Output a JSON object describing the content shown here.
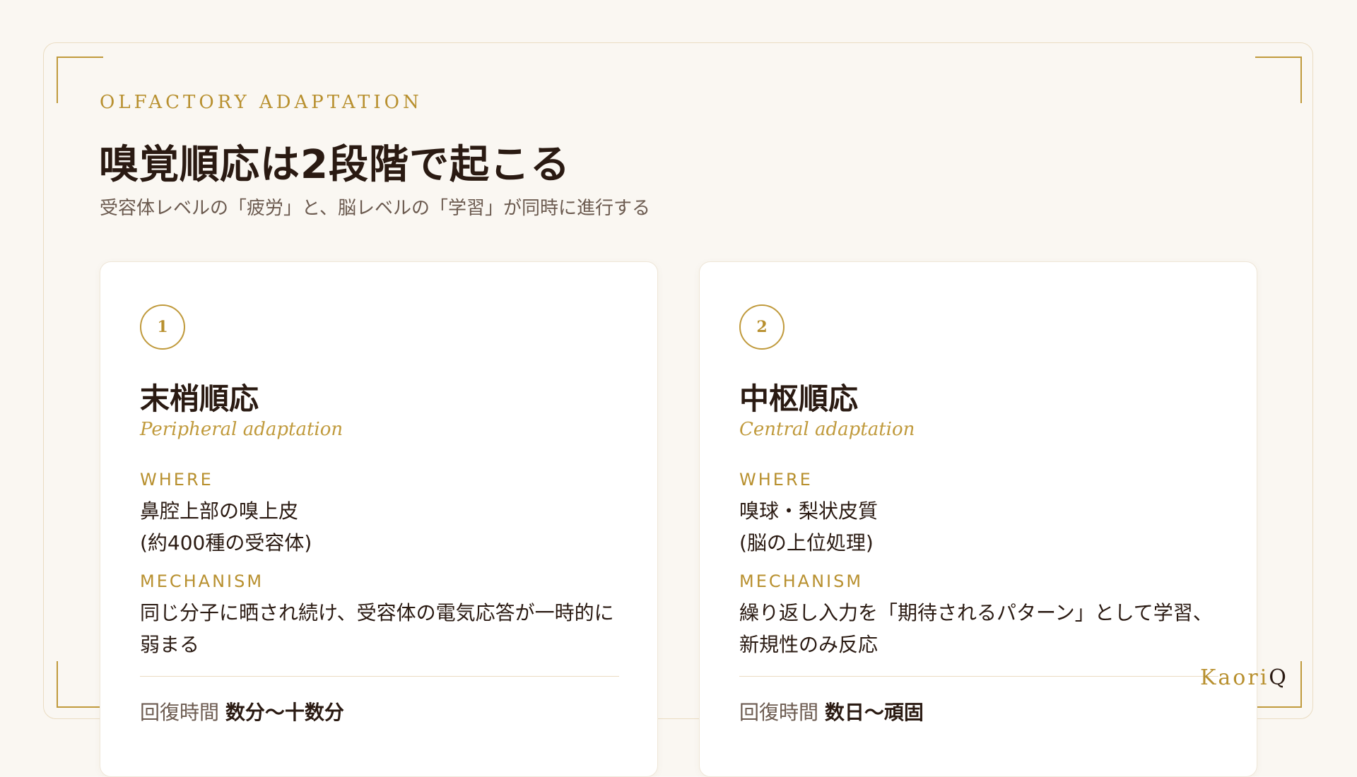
{
  "header": {
    "eyebrow": "OLFACTORY ADAPTATION",
    "title": "嗅覚順応は2段階で起こる",
    "subtitle": "受容体レベルの「疲労」と、脳レベルの「学習」が同時に進行する"
  },
  "cards": [
    {
      "number": "1",
      "title": "末梢順応",
      "subtitle": "Peripheral adaptation",
      "where_label": "WHERE",
      "where_line1": "鼻腔上部の嗅上皮",
      "where_line2": "(約400種の受容体)",
      "mechanism_label": "MECHANISM",
      "mechanism": "同じ分子に晒され続け、受容体の電気応答が一時的に弱まる",
      "recovery_label": "回復時間",
      "recovery_value": "数分〜十数分"
    },
    {
      "number": "2",
      "title": "中枢順応",
      "subtitle": "Central adaptation",
      "where_label": "WHERE",
      "where_line1": "嗅球・梨状皮質",
      "where_line2": "(脳の上位処理)",
      "mechanism_label": "MECHANISM",
      "mechanism": "繰り返し入力を「期待されるパターン」として学習、新規性のみ反応",
      "recovery_label": "回復時間",
      "recovery_value": "数日〜頑固"
    }
  ],
  "brand": {
    "name": "Kaori",
    "suffix": "Q"
  },
  "colors": {
    "accent_gold": "#c09a3c",
    "text_dark": "#2a1a12",
    "background": "#faf7f2"
  }
}
